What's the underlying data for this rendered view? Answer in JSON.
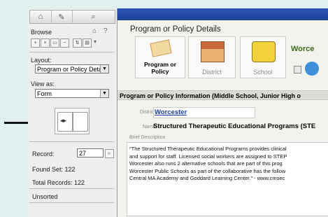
{
  "sidebar": {
    "browse_label": "Browse",
    "layout_label": "Layout:",
    "layout_value": "Program or Policy Deta",
    "view_as_label": "View as:",
    "view_as_value": "Form",
    "record_label": "Record:",
    "record_value": "27",
    "found_set": "Found Set: 122",
    "total_records": "Total Records: 122",
    "sort_status": "Unsorted"
  },
  "main": {
    "title": "Program or Policy Details",
    "nav": [
      {
        "label": "Program or\nPolicy"
      },
      {
        "label": "District"
      },
      {
        "label": "School"
      },
      {
        "label": "Worce"
      }
    ],
    "info_bar": "Program or Policy Information (Middle School, Junior High o",
    "district_label": "District",
    "district_value": "Worcester",
    "name_label": "Name",
    "name_value": "Structured Therapeutic Educational Programs (STE",
    "brief_label": "Brief Description",
    "description_lines": [
      "\"The Structured Therapeutic Educational Programs provides clinical",
      "and support for staff. Licensed social workers are assigned to STEP",
      "Worcester also runs 2 alternative schools that are part of this prog",
      "Worcester Public Schools as part of the collaborative has the follow",
      "Central MA Academy and Goddard Learning Center.\" - www.cmsec"
    ]
  }
}
